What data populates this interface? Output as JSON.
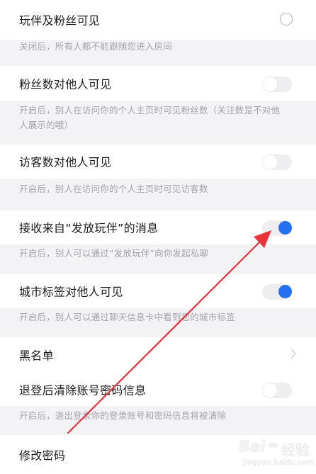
{
  "settings": {
    "partner_fans_visible": {
      "label": "玩伴及粉丝可见",
      "desc": "关闭后，所有人都不能跟随您进入房间",
      "control": "radio",
      "checked": false
    },
    "fans_count_visible": {
      "label": "粉丝数对他人可见",
      "desc_line1": "开启后，别人在访问你的个人主页时可见粉丝数（关注数是不对他",
      "desc_line2": "人展示的哦）",
      "control": "toggle",
      "on": false
    },
    "visitor_count_visible": {
      "label": "访客数对他人可见",
      "desc": "开启后，别人在访问你的个人主页时可见访客数",
      "control": "toggle",
      "on": false
    },
    "receive_fafang_messages": {
      "label": "接收来自“发放玩伴”的消息",
      "desc": "开启后，别人可以通过“发放玩伴”向你发起私聊",
      "control": "toggle",
      "on": true
    },
    "city_tag_visible": {
      "label": "城市标签对他人可见",
      "desc": "开启后，别人可以通过聊天信息卡中看到您的城市标签",
      "control": "toggle",
      "on": true
    },
    "blacklist": {
      "label": "黑名单",
      "control": "chevron"
    },
    "clear_account_on_logout": {
      "label": "退登后清除账号密码信息",
      "desc": "开启后，退出登录你的登录账号和密码信息将被清除",
      "control": "toggle",
      "on": false
    },
    "change_password": {
      "label": "修改密码"
    }
  },
  "colors": {
    "accent": "#2470f0",
    "annotation_arrow": "#e8343a",
    "background": "#f3f3f6"
  },
  "watermark": {
    "brand": "Bai",
    "paw": "du",
    "suffix": "经验",
    "domain": "jingyan.baidu.com"
  }
}
